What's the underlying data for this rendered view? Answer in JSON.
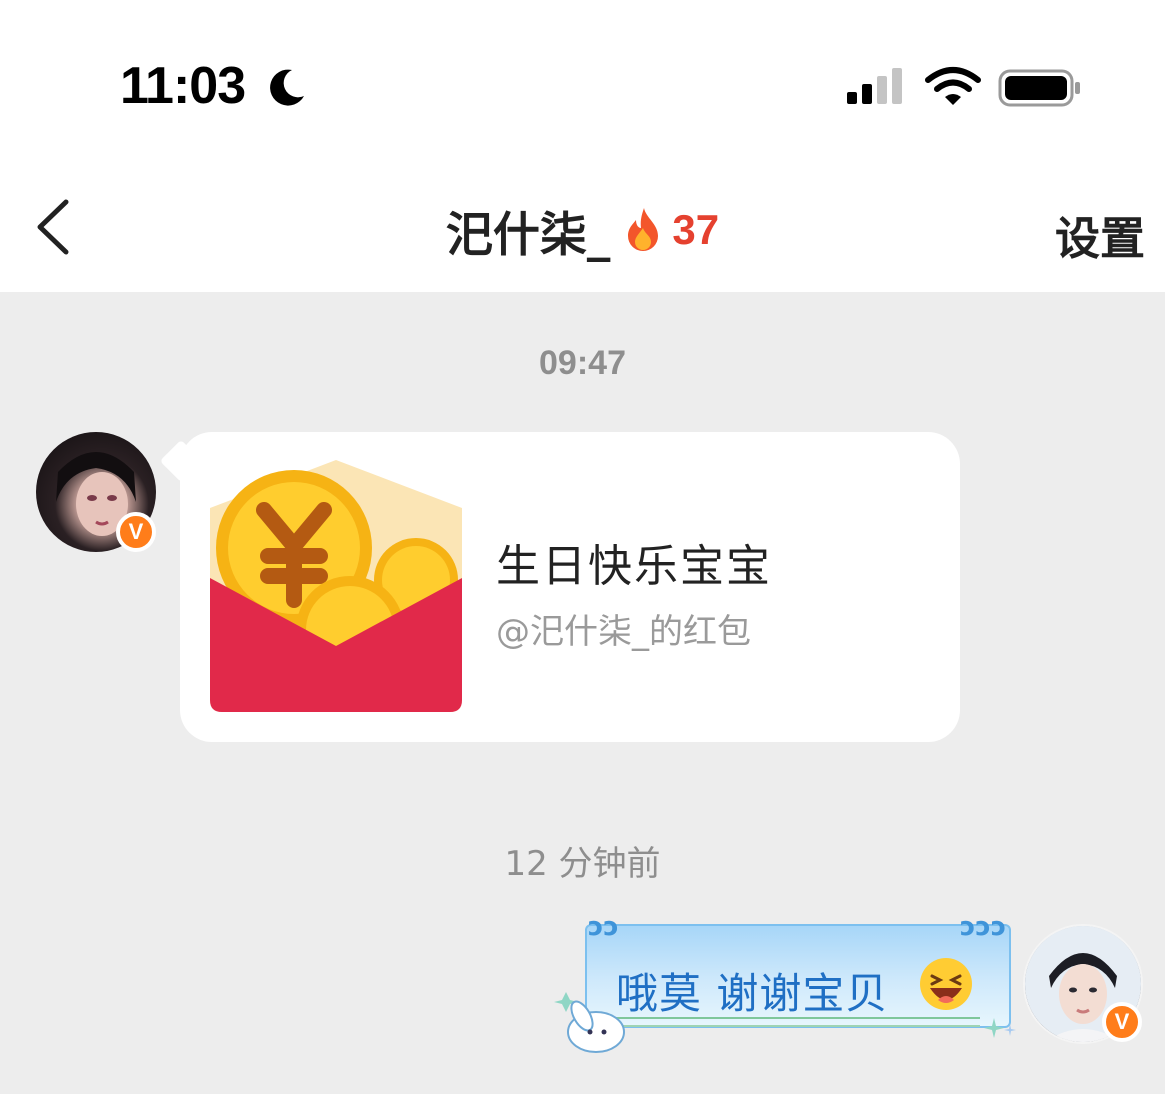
{
  "status_bar": {
    "time": "11:03",
    "icons": [
      "moon-icon",
      "signal-icon",
      "wifi-icon",
      "battery-icon"
    ]
  },
  "nav": {
    "back_icon": "chevron-left-icon",
    "title": "汜什柒_",
    "streak_icon": "fire-icon",
    "streak_count": "37",
    "settings_label": "设置"
  },
  "chat": {
    "timestamp_1": "09:47",
    "red_packet": {
      "title": "生日快乐宝宝",
      "subtitle": "@汜什柒_的红包"
    },
    "timestamp_2": "12 分钟前",
    "outgoing_message": {
      "text": "哦莫 谢谢宝贝",
      "emoji": "laughing-tears-icon"
    },
    "badge_letter": "V"
  },
  "colors": {
    "accent_fire": "#e5412f",
    "badge_orange": "#ff7d1a",
    "packet_red": "#e1294a",
    "bubble_blue": "#a7d6f8",
    "message_text": "#1f6fc4",
    "chat_bg": "#ededed"
  }
}
